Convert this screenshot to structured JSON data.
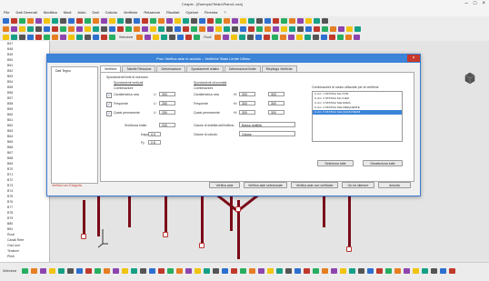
{
  "app": {
    "title": "Ceapie - [Esempio\\Telaio\\Piano1.cea]",
    "window_controls": [
      "–",
      "□",
      "×"
    ]
  },
  "menu": [
    "File",
    "Dati Generali",
    "Modifica",
    "Modi",
    "Aiuto",
    "Dati",
    "Calcolo",
    "Verifiche",
    "Relazione",
    "Risultati",
    "Opzioni",
    "Finestra",
    "?"
  ],
  "toolbar3": {
    "label1": "Selezione",
    "label2": "Ruoli"
  },
  "tree": {
    "items": [
      "B47",
      "B48",
      "B49",
      "B50",
      "B51",
      "B52",
      "B53",
      "B54",
      "B55",
      "B56",
      "B57",
      "B58",
      "B59",
      "B60",
      "B61",
      "B62",
      "B63",
      "B64",
      "B65",
      "B66",
      "B67",
      "B68",
      "B69",
      "B70",
      "B71",
      "B72",
      "B73",
      "B74",
      "B75",
      "B76",
      "B77",
      "B78",
      "B79",
      "B80",
      "B81",
      "Ruoli",
      "Canali Rete",
      "Grid Line",
      "Tensioni",
      "Plinti"
    ]
  },
  "dialog": {
    "title": "Proc Verifica aste in acciaio – Verifiche Stato Limite Ultimo",
    "close": "×",
    "left_item": "Dati Tegno",
    "tabs": [
      "Verifiche",
      "Tabelle Flessione",
      "Deformazione",
      "Spostamenti relativi",
      "Deformazioni limite",
      "Riepilogo Verifiche"
    ],
    "sections": {
      "left_title": "Spostamenti limiti di esercizio",
      "left_sub": "Spostamenti verticali",
      "left_sub2": "Combinazioni",
      "mid_title": "Spostamenti orizzontali",
      "mid_sub": "Combinazioni",
      "right_title": "Combinazioni di carico utilizzate per le verifiche"
    },
    "rows": [
      {
        "label": "Caratteristica rara",
        "checked": "✓",
        "sym": "L/",
        "val": "300",
        "mlabel": "Caratteristica rara",
        "msym": "H/",
        "mval": "300",
        "mval2": "300"
      },
      {
        "label": "Frequente",
        "checked": "✓",
        "sym": "L/",
        "val": "250",
        "mlabel": "Frequente",
        "msym": "H/",
        "mval": "300",
        "mval2": "300"
      },
      {
        "label": "Quasi permanente",
        "checked": "✓",
        "sym": "L/",
        "val": "250",
        "mlabel": "Quasi permanente",
        "msym": "H/",
        "mval": "300",
        "mval2": "300"
      }
    ],
    "extra": {
      "snellezza_label": "Snellezza limite",
      "snellezza_val": "200",
      "kappa_label": "Kappa",
      "kappa_val": "0.9",
      "fy_label": "Fy",
      "fy_val": "0.8",
      "class_label": "Classe di duttilità dell'edificio",
      "class_val": "Bassa duttilità",
      "calc_label": "Classe di calcolo",
      "calc_val": "Classe"
    },
    "combos": [
      "C.d.C. 1 STATICA SLU STR",
      "C.d.C. 2 STATICA SLU GEO",
      "C.d.C. 3 STATICA SLE RARA",
      "C.d.C. 4 STATICA SLE FREQUENTE",
      "C.d.C. 5 STATICA SLE QUASI PERM."
    ],
    "combos_selected_index": 4,
    "right_buttons": [
      "Seleziona tutte",
      "Deseleziona tutte"
    ],
    "bottom_buttons": [
      "Verifica aste",
      "Verifica aste selezionate",
      "Verifica aste non verificate",
      "Ok ed ulteriore",
      "Annulla"
    ],
    "status": "Verifica non Eseguita"
  },
  "statusbar": {
    "label": "Selezione"
  },
  "colors": {
    "accent": "#3b84d8",
    "frame": "#7a0a18",
    "close": "#c7382b"
  }
}
